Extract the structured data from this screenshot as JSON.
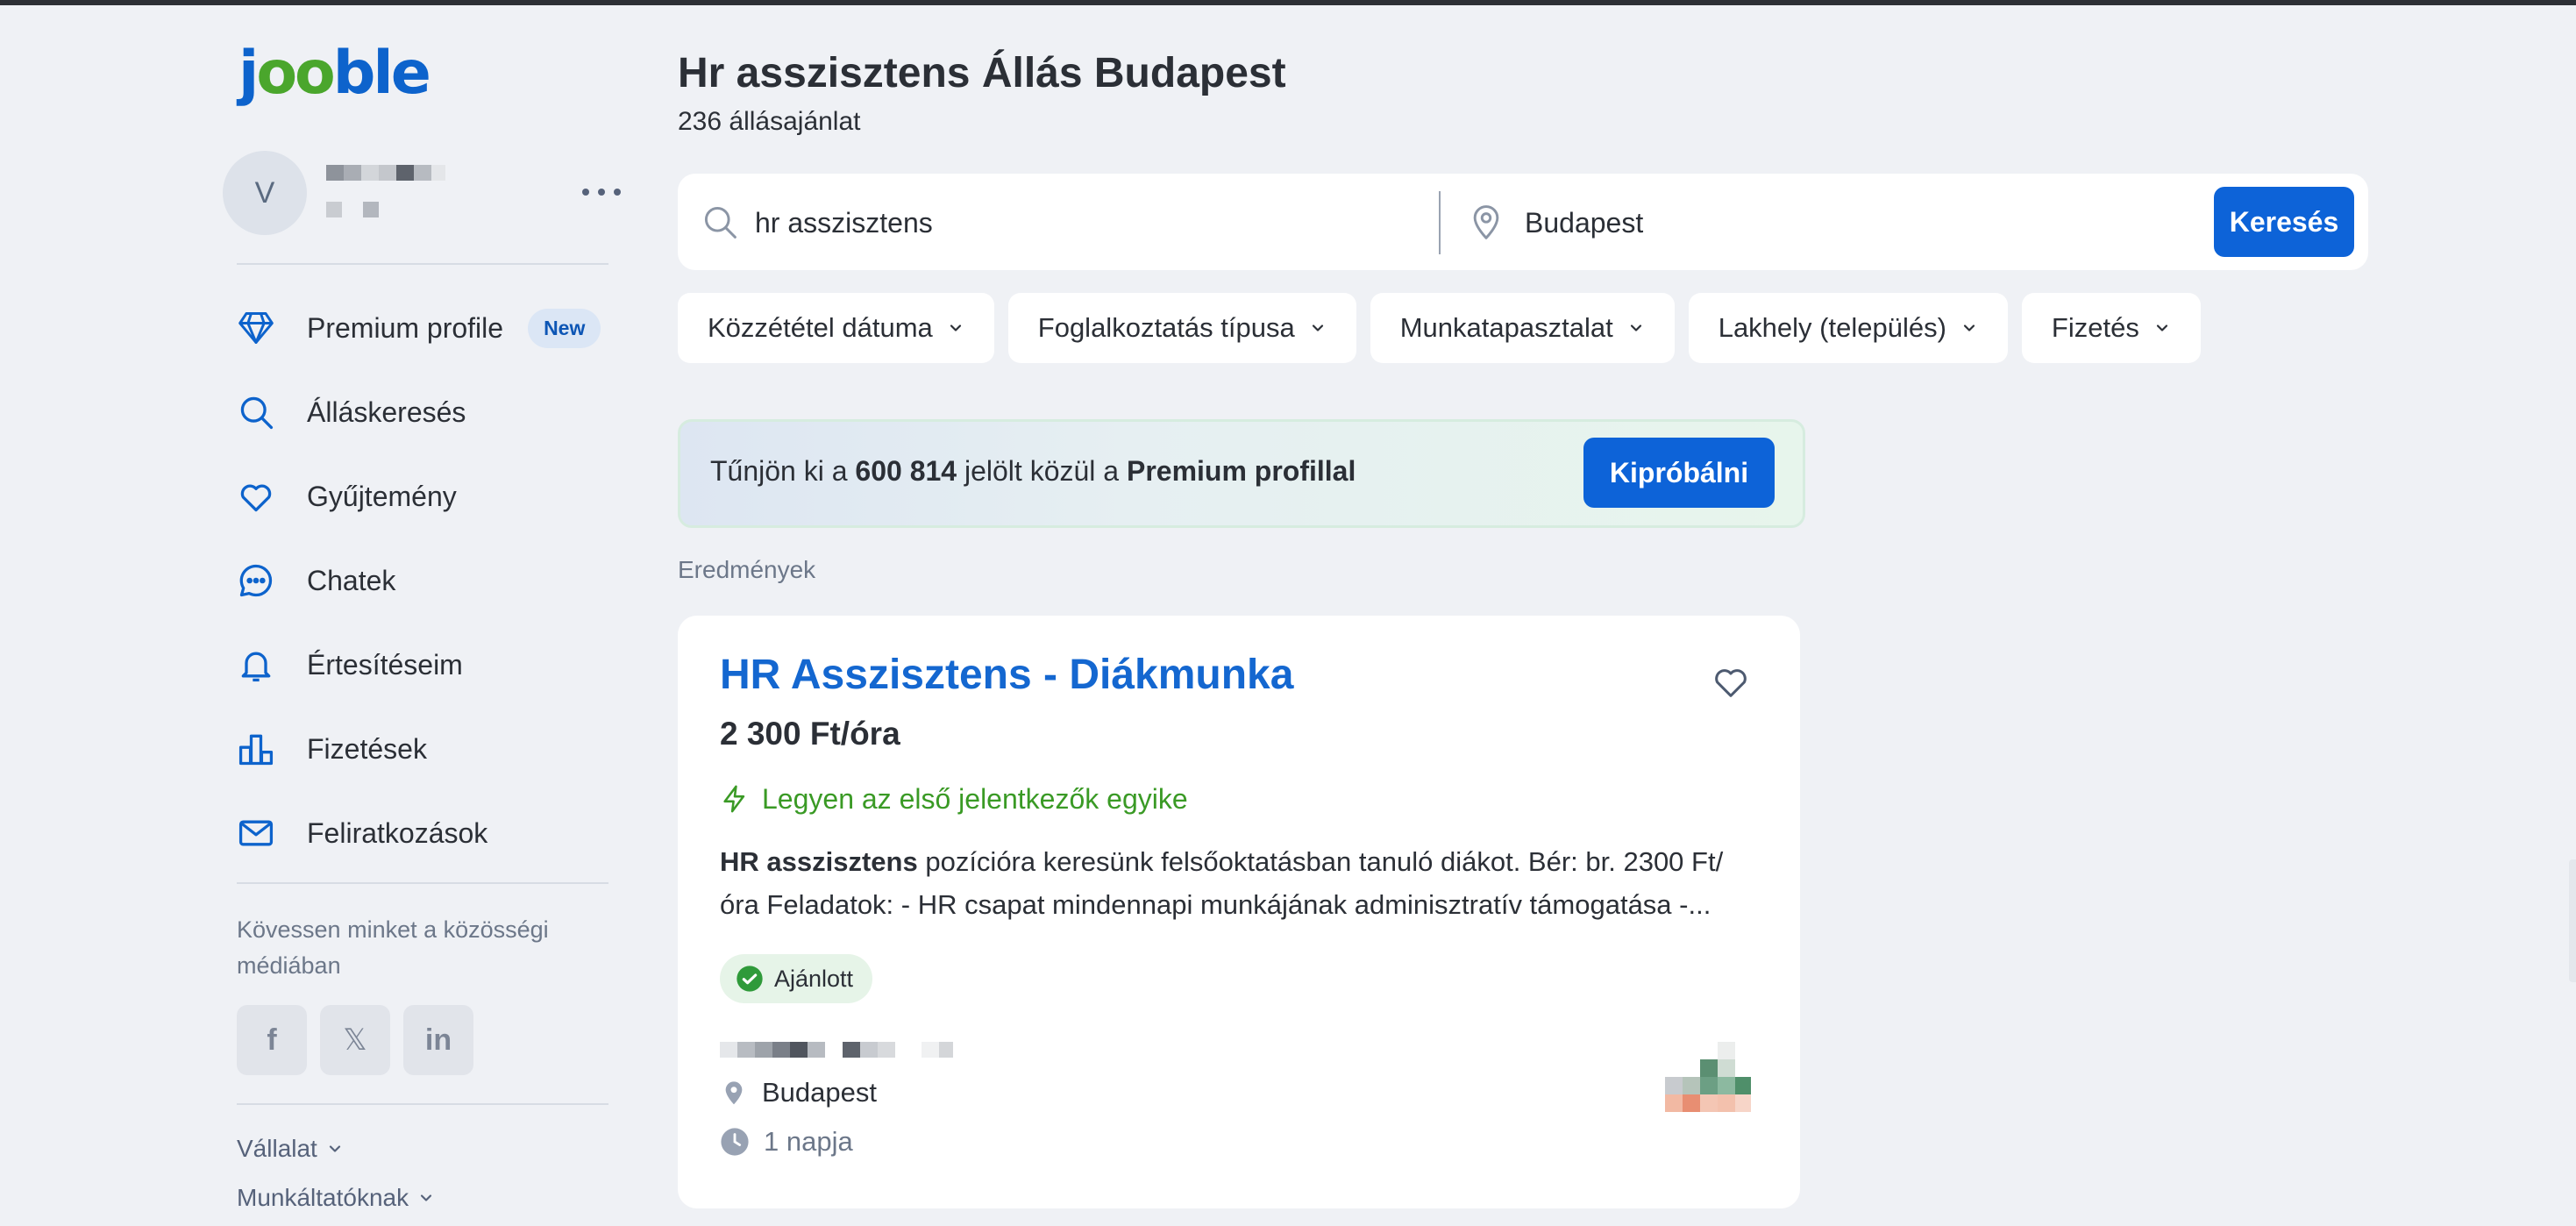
{
  "brand": {
    "logo_j": "j",
    "logo_oo": "oo",
    "logo_ble": "ble"
  },
  "user": {
    "avatar_initial": "V"
  },
  "sidebar": {
    "items": [
      {
        "label": "Premium profile",
        "icon": "diamond-icon",
        "badge": "New"
      },
      {
        "label": "Álláskeresés",
        "icon": "search-icon"
      },
      {
        "label": "Gyűjtemény",
        "icon": "heart-icon"
      },
      {
        "label": "Chatek",
        "icon": "chat-icon"
      },
      {
        "label": "Értesítéseim",
        "icon": "bell-icon"
      },
      {
        "label": "Fizetések",
        "icon": "bar-chart-icon"
      },
      {
        "label": "Feliratkozások",
        "icon": "mail-icon"
      }
    ],
    "follow_text": "Kövessen minket a közösségi médiában",
    "socials": [
      {
        "glyph": "f",
        "icon": "facebook-icon"
      },
      {
        "glyph": "𝕏",
        "icon": "x-icon"
      },
      {
        "glyph": "in",
        "icon": "linkedin-icon"
      }
    ],
    "footer": {
      "company": "Vállalat",
      "employers": "Munkáltatóknak"
    }
  },
  "main": {
    "title": "Hr asszisztens Állás Budapest",
    "count": "236 állásajánlat",
    "search": {
      "query": "hr asszisztens",
      "location": "Budapest",
      "button": "Keresés"
    },
    "filters": [
      "Közzététel dátuma",
      "Foglalkoztatás típusa",
      "Munkatapasztalat",
      "Lakhely (település)",
      "Fizetés"
    ],
    "promo": {
      "text_before": "Tűnjön ki a ",
      "number": "600 814",
      "text_middle": " jelölt közül a ",
      "text_bold": "Premium profillal",
      "button": "Kipróbálni"
    },
    "results_label": "Eredmények",
    "job": {
      "title": "HR Asszisztens - Diákmunka",
      "salary": "2 300 Ft/óra",
      "first_applicant": "Legyen az első jelentkezők egyike",
      "desc_bold": "HR asszisztens",
      "desc_rest": " pozícióra keresünk felsőoktatásban tanuló diákot. Bér: br. 2300 Ft/óra Feladatok: - HR csapat mindennapi munkájának adminisztratív támogatása -...",
      "recommended": "Ajánlott",
      "location": "Budapest",
      "posted": "1 napja"
    }
  },
  "colors": {
    "accent": "#0d63d8",
    "link": "#1467d0",
    "green": "#3a9a25",
    "background": "#eff1f5"
  }
}
